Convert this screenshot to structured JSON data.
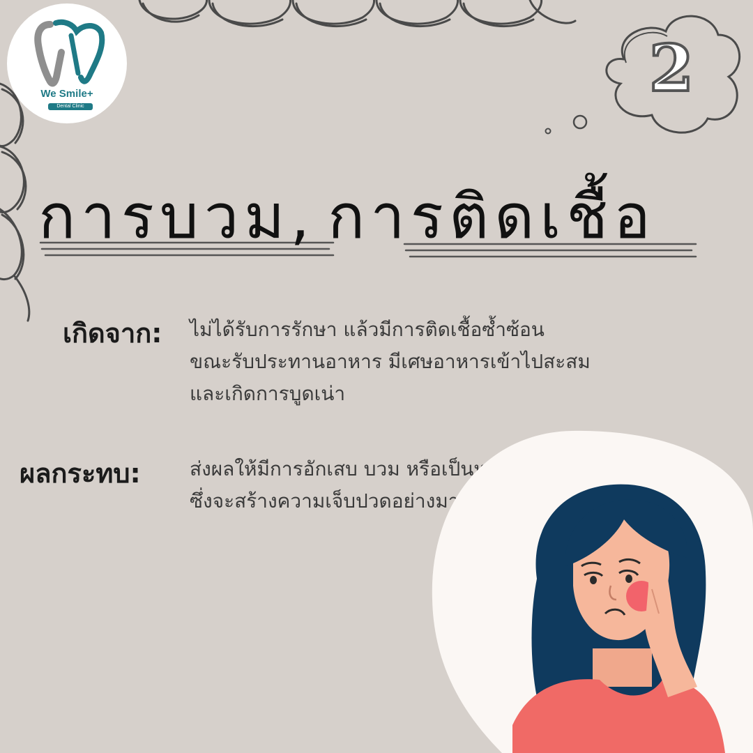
{
  "brand": {
    "name": "We Smile+",
    "subtitle": "Dental Clinic",
    "accent_color": "#1f7a86"
  },
  "badge": {
    "number": "2",
    "icon": "cloud-badge-icon"
  },
  "title": {
    "part1": "การบวม,",
    "part2": "การติดเชื้อ"
  },
  "sections": {
    "cause": {
      "label": "เกิดจาก:",
      "lines": [
        "ไม่ได้รับการรักษา แล้วมีการติดเชื้อซ้ำซ้อน",
        "ขณะรับประทานอาหาร มีเศษอาหารเข้าไปสะสม",
        "และเกิดการบูดเน่า"
      ]
    },
    "effect": {
      "label": "ผลกระทบ:",
      "lines": [
        "ส่งผลให้มีการอักเสบ บวม หรือเป็นหนอง",
        "ซึ่งจะสร้างความเจ็บปวดอย่างมาก"
      ]
    }
  },
  "colors": {
    "background": "#d6d0cb",
    "title_text": "#111111",
    "hair": "#0f3a5e",
    "shirt": "#f06a66",
    "skin": "#f6b79b",
    "cheek": "#f2636b"
  },
  "illustration": {
    "icon": "woman-toothache-icon"
  }
}
